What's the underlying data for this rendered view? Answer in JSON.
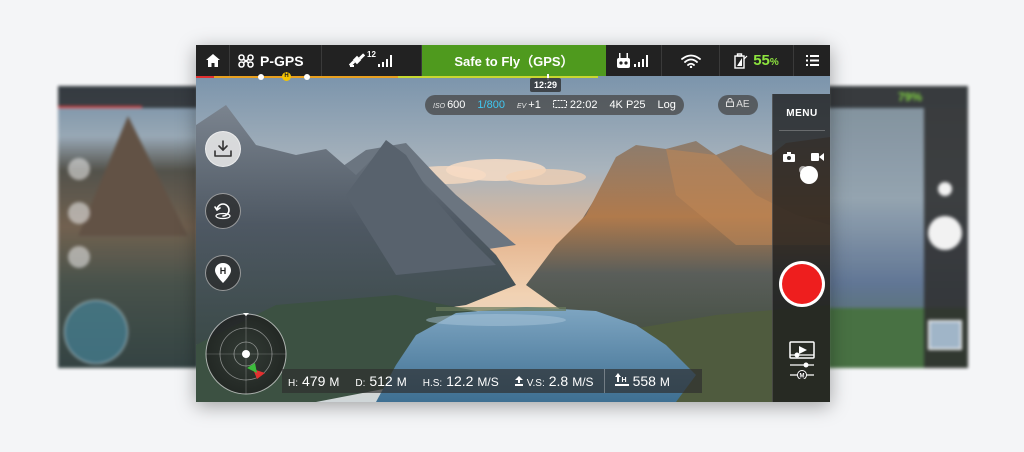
{
  "top_bar": {
    "mode": "P-GPS",
    "satellites": "12",
    "status": "Safe to Fly（GPS）",
    "battery_pct": "55",
    "battery_unit": "%"
  },
  "flight_time": "12:29",
  "camera": {
    "iso_label": "ISO",
    "iso": "600",
    "shutter": "1/800",
    "ev_label": "EV",
    "ev": "+1",
    "remaining_time": "22:02",
    "resolution": "4K P25",
    "color": "Log",
    "ae": "AE"
  },
  "side_panel": {
    "menu_label": "MENU"
  },
  "telemetry": {
    "h_label": "H:",
    "h_value": "479",
    "h_unit": "M",
    "d_label": "D:",
    "d_value": "512",
    "d_unit": "M",
    "hs_label": "H.S:",
    "hs_value": "12.2",
    "hs_unit": "M/S",
    "vs_label": "V.S:",
    "vs_value": "2.8",
    "vs_unit": "M/S",
    "dist_value": "558",
    "dist_unit": "M"
  },
  "blurred_right": {
    "battery_pct": "79%"
  },
  "colors": {
    "status_green": "#4f9a1e",
    "battery_green": "#8ee53f",
    "record_red": "#ee1e1e",
    "shutter_cyan": "#3fc8f2"
  },
  "icons": [
    "home-icon",
    "drone-icon",
    "satellite-icon",
    "signal-bars-icon",
    "remote-controller-icon",
    "wifi-icon",
    "battery-icon",
    "list-menu-icon",
    "takeoff-icon",
    "return-home-icon",
    "home-point-icon",
    "photo-icon",
    "video-icon",
    "playback-icon",
    "camera-settings-icon"
  ]
}
